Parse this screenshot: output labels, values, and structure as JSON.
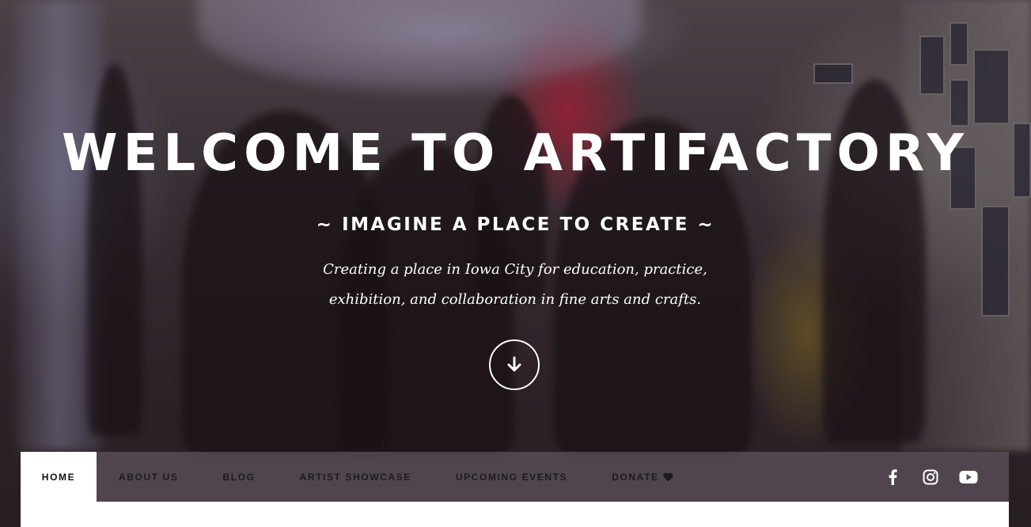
{
  "hero": {
    "title": "WELCOME TO ARTIFACTORY",
    "subtitle": "~ IMAGINE A PLACE TO CREATE ~",
    "description": "Creating a place in Iowa City for education, practice, exhibition, and collaboration in fine arts and crafts.",
    "scroll_icon": "arrow-down-icon"
  },
  "nav": {
    "items": [
      {
        "label": "HOME",
        "active": true
      },
      {
        "label": "ABOUT US",
        "active": false
      },
      {
        "label": "BLOG",
        "active": false
      },
      {
        "label": "ARTIST SHOWCASE",
        "active": false
      },
      {
        "label": "UPCOMING EVENTS",
        "active": false
      },
      {
        "label": "DONATE",
        "active": false,
        "icon": "heart-icon"
      }
    ],
    "social": [
      "facebook-icon",
      "instagram-icon",
      "youtube-icon"
    ]
  },
  "colors": {
    "nav_background": "#5f555f",
    "nav_active_background": "#ffffff",
    "nav_text": "#1b1b1f",
    "hero_text": "#ffffff"
  }
}
